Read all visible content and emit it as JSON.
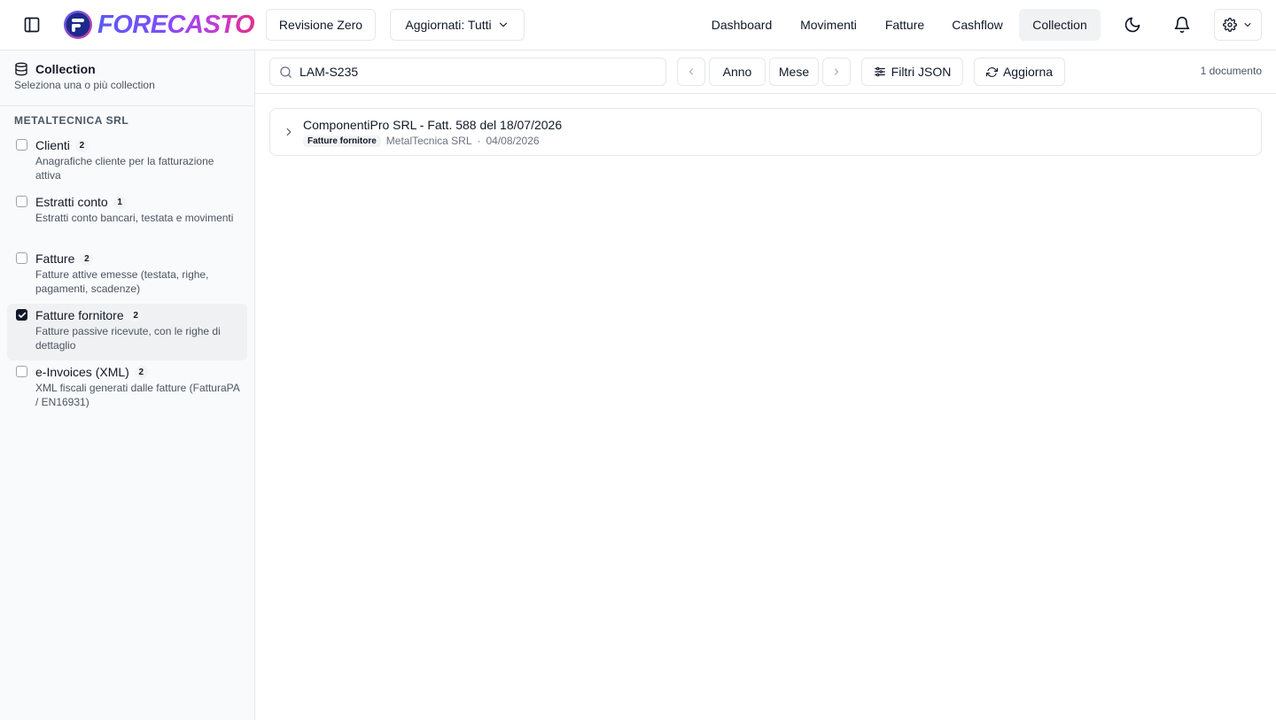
{
  "header": {
    "logo_text": "FORECASTO",
    "revisione_label": "Revisione Zero",
    "aggiornati_label": "Aggiornati: Tutti",
    "nav": [
      {
        "label": "Dashboard"
      },
      {
        "label": "Movimenti"
      },
      {
        "label": "Fatture"
      },
      {
        "label": "Cashflow"
      },
      {
        "label": "Collection"
      }
    ],
    "active_nav": "Collection"
  },
  "sidebar": {
    "title": "Collection",
    "subtitle": "Seleziona una o più collection",
    "group": "METALTECNICA SRL",
    "items": [
      {
        "name": "Clienti",
        "count": "2",
        "desc": "Anagrafiche cliente per la fatturazione attiva",
        "checked": false
      },
      {
        "name": "Estratti conto",
        "count": "1",
        "desc": "Estratti conto bancari, testata e movimenti",
        "checked": false
      },
      {
        "name": "Fatture",
        "count": "2",
        "desc": "Fatture attive emesse (testata, righe, pagamenti, scadenze)",
        "checked": false
      },
      {
        "name": "Fatture fornitore",
        "count": "2",
        "desc": "Fatture passive ricevute, con le righe di dettaglio",
        "checked": true
      },
      {
        "name": "e-Invoices (XML)",
        "count": "2",
        "desc": "XML fiscali generati dalle fatture (FatturaPA / EN16931)",
        "checked": false
      }
    ]
  },
  "toolbar": {
    "search_value": "LAM-S235",
    "anno_label": "Anno",
    "mese_label": "Mese",
    "filtri_label": "Filtri JSON",
    "aggiorna_label": "Aggiorna",
    "doc_count": "1 documento"
  },
  "documents": [
    {
      "title": "ComponentiPro SRL - Fatt. 588 del 18/07/2026",
      "badge": "Fatture fornitore",
      "company": "MetalTecnica SRL",
      "separator": "·",
      "date": "04/08/2026"
    }
  ],
  "colors": {
    "border": "#e5e7eb",
    "sidebar_bg": "#f9fafb",
    "active_nav_bg": "#f1f2f4",
    "brand_gradient_start": "#5b5bf0",
    "brand_gradient_end": "#e0308f"
  }
}
